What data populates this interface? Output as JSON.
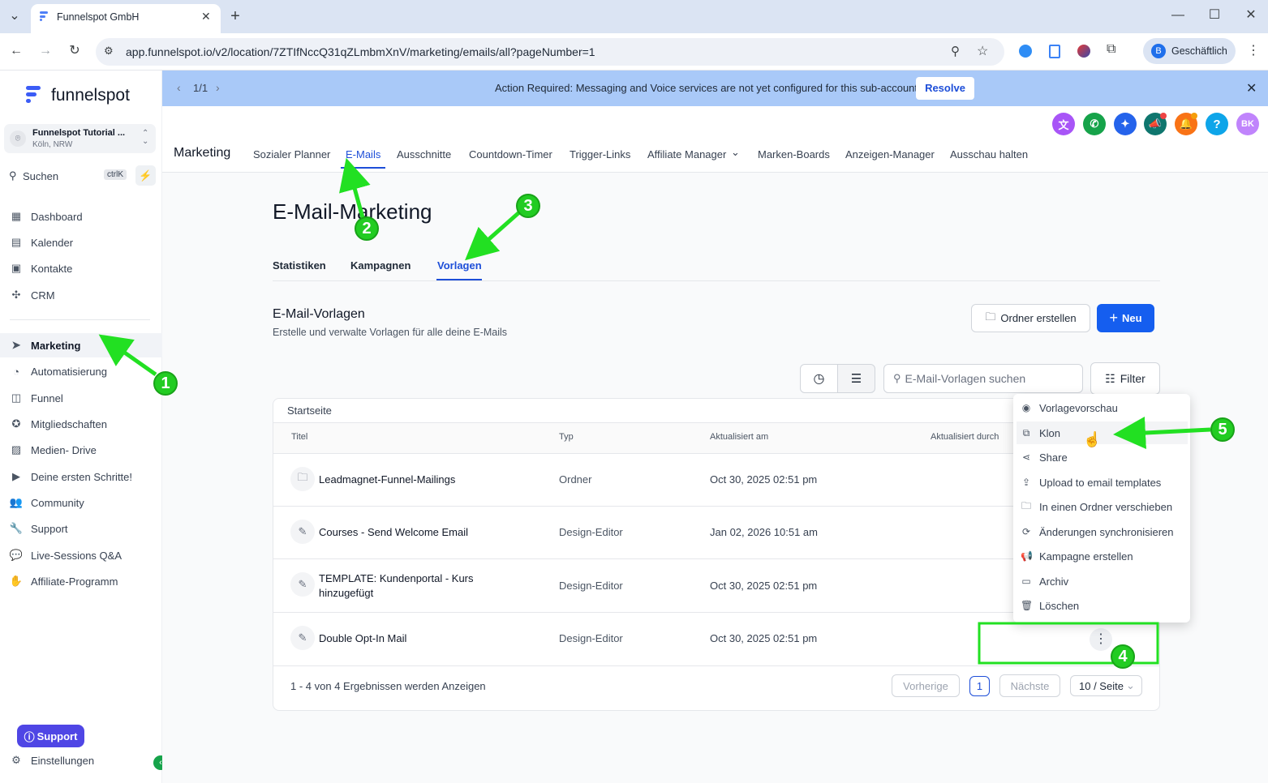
{
  "browser": {
    "tab_title": "Funnelspot GmbH",
    "url": "app.funnelspot.io/v2/location/7ZTIfNccQ31qZLmbmXnV/marketing/emails/all?pageNumber=1",
    "profile_initial": "B",
    "profile_label": "Geschäftlich"
  },
  "brand": {
    "name": "funnelspot",
    "accent": "#155eef"
  },
  "account": {
    "name": "Funnelspot Tutorial ...",
    "location": "Köln, NRW"
  },
  "search": {
    "label": "Suchen",
    "shortcut": "ctrlK"
  },
  "sidebar": {
    "items": [
      {
        "label": "Dashboard",
        "icon": "grid-icon"
      },
      {
        "label": "Kalender",
        "icon": "calendar-icon"
      },
      {
        "label": "Kontakte",
        "icon": "contacts-icon"
      },
      {
        "label": "CRM",
        "icon": "crm-icon"
      },
      {
        "label": "Marketing",
        "icon": "send-icon",
        "active": true
      },
      {
        "label": "Automatisierung",
        "icon": "automation-icon"
      },
      {
        "label": "Funnel",
        "icon": "funnel-icon"
      },
      {
        "label": "Mitgliedschaften",
        "icon": "badge-icon"
      },
      {
        "label": "Medien- Drive",
        "icon": "image-icon"
      },
      {
        "label": "Deine ersten Schritte!",
        "icon": "play-icon"
      },
      {
        "label": "Community",
        "icon": "users-icon"
      },
      {
        "label": "Support",
        "icon": "wrench-icon"
      },
      {
        "label": "Live-Sessions Q&A",
        "icon": "chat-icon"
      },
      {
        "label": "Affiliate-Programm",
        "icon": "hand-icon"
      }
    ],
    "support_button": "Support",
    "settings": "Einstellungen"
  },
  "banner": {
    "pager": "1/1",
    "message": "Action Required: Messaging and Voice services are not yet configured for this sub-account!",
    "button": "Resolve"
  },
  "header_icons": {
    "avatar_initials": "BK",
    "help": "?"
  },
  "topnav": {
    "section": "Marketing",
    "links": [
      "Sozialer Planner",
      "E-Mails",
      "Ausschnitte",
      "Countdown-Timer",
      "Trigger-Links",
      "Affiliate Manager",
      "Marken-Boards",
      "Anzeigen-Manager",
      "Ausschau halten"
    ],
    "active": "E-Mails"
  },
  "page": {
    "title": "E-Mail-Marketing",
    "tabs": [
      "Statistiken",
      "Kampagnen",
      "Vorlagen"
    ],
    "active_tab": "Vorlagen",
    "section_title": "E-Mail-Vorlagen",
    "section_subtitle": "Erstelle und verwalte Vorlagen für alle deine E-Mails",
    "create_folder": "Ordner erstellen",
    "new_button": "Neu",
    "search_placeholder": "E-Mail-Vorlagen suchen",
    "filter": "Filter",
    "breadcrumb": "Startseite"
  },
  "table": {
    "columns": [
      "Titel",
      "Typ",
      "Aktualisiert am",
      "Aktualisiert durch"
    ],
    "rows": [
      {
        "title": "Leadmagnet-Funnel-Mailings",
        "type": "Ordner",
        "updated": "Oct 30, 2025 02:51 pm",
        "icon": "folder-icon"
      },
      {
        "title": "Courses - Send Welcome Email",
        "type": "Design-Editor",
        "updated": "Jan 02, 2026 10:51 am",
        "icon": "brush-icon"
      },
      {
        "title": "TEMPLATE: Kundenportal - Kurs hinzugefügt",
        "type": "Design-Editor",
        "updated": "Oct 30, 2025 02:51 pm",
        "icon": "brush-icon"
      },
      {
        "title": "Double Opt-In Mail",
        "type": "Design-Editor",
        "updated": "Oct 30, 2025 02:51 pm",
        "icon": "brush-icon"
      }
    ],
    "summary": "1 - 4 von 4 Ergebnissen werden Anzeigen",
    "prev": "Vorherige",
    "page": "1",
    "next": "Nächste",
    "per_page": "10 / Seite"
  },
  "menu": {
    "items": [
      {
        "label": "Vorlagevorschau",
        "icon": "eye-icon"
      },
      {
        "label": "Klon",
        "icon": "copy-icon"
      },
      {
        "label": "Share",
        "icon": "share-icon"
      },
      {
        "label": "Upload to email templates",
        "icon": "upload-icon"
      },
      {
        "label": "In einen Ordner verschieben",
        "icon": "folder-move-icon"
      },
      {
        "label": "Änderungen synchronisieren",
        "icon": "sync-icon"
      },
      {
        "label": "Kampagne erstellen",
        "icon": "megaphone-icon"
      },
      {
        "label": "Archiv",
        "icon": "archive-icon"
      },
      {
        "label": "Löschen",
        "icon": "trash-icon"
      }
    ]
  },
  "annotations": [
    "1",
    "2",
    "3",
    "4",
    "5"
  ]
}
